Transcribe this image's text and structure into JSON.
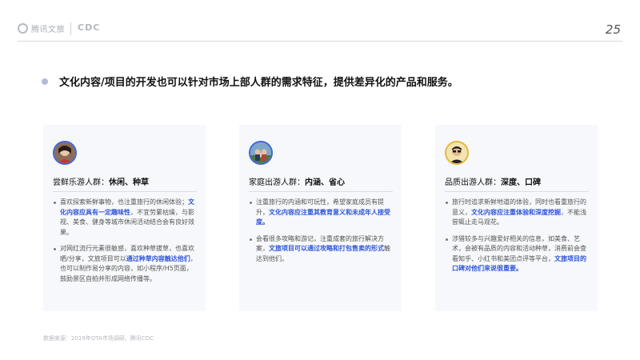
{
  "header": {
    "brand_tencent": "腾讯文旅",
    "brand_cdc": "CDC",
    "page_number": "25"
  },
  "headline": "文化内容/项目的开发也可以针对市场上部人群的需求特征，提供差异化的产品和服务。",
  "cards": [
    {
      "title_prefix": "尝鲜乐游人群：",
      "title_highlight": "休闲、种草",
      "bullets": [
        {
          "t1": "喜欢探索新鲜事物，也注重旅行的休闲体验；",
          "blue": "文化内容应具有一定趣味性",
          "t2": "，不宜劳累枯燥，与影视、美食、健身等城市休闲活动结合会有良好效果。"
        },
        {
          "t1": "对网红流行元素很敏感，喜欢种草拔草，也喜欢晒/分享，文旅项目可以",
          "blue": "通过种草内容触达他们",
          "t2": "，也可以制作易分享的内容，如小程序/H5页面，鼓励景区自拍并形成网络传播等。"
        }
      ]
    },
    {
      "title_prefix": "家庭出游人群：",
      "title_highlight": "内涵、省心",
      "bullets": [
        {
          "t1": "注重旅行的内涵和可玩性，希望家庭成员有提升，",
          "blue": "文化内容应注重其教育意义和未成年人接受度。",
          "t2": ""
        },
        {
          "t1": "会看很多攻略和游记，注重成套的旅行解决方案，",
          "blue": "文旅项目可以通过攻略和打包售卖的形式",
          "t2": "触达到他们。"
        }
      ]
    },
    {
      "title_prefix": "品质出游人群：",
      "title_highlight": "深度、口碑",
      "bullets": [
        {
          "t1": "旅行时追求新鲜地道的体验，同时也看重旅行的意义，",
          "blue": "文化内容应注重体验和深度挖掘",
          "t2": "，不能浅尝辄止走马观花。"
        },
        {
          "t1": "涉猎较多与兴趣爱好相关的信息，如美食、艺术，会被有品质的内容和活动种草，消费前会查看知乎、小红书和美团点评等平台，",
          "blue": "文旅项目的口碑对他们来说很重要。",
          "t2": ""
        }
      ]
    }
  ],
  "source": "数据来源：2019年OTA市场调研、腾讯CDC",
  "colors": {
    "accent_blue": "#2d55d6",
    "card_bg": "#f7f8fb",
    "bullet_dot": "#b5bbd6"
  }
}
